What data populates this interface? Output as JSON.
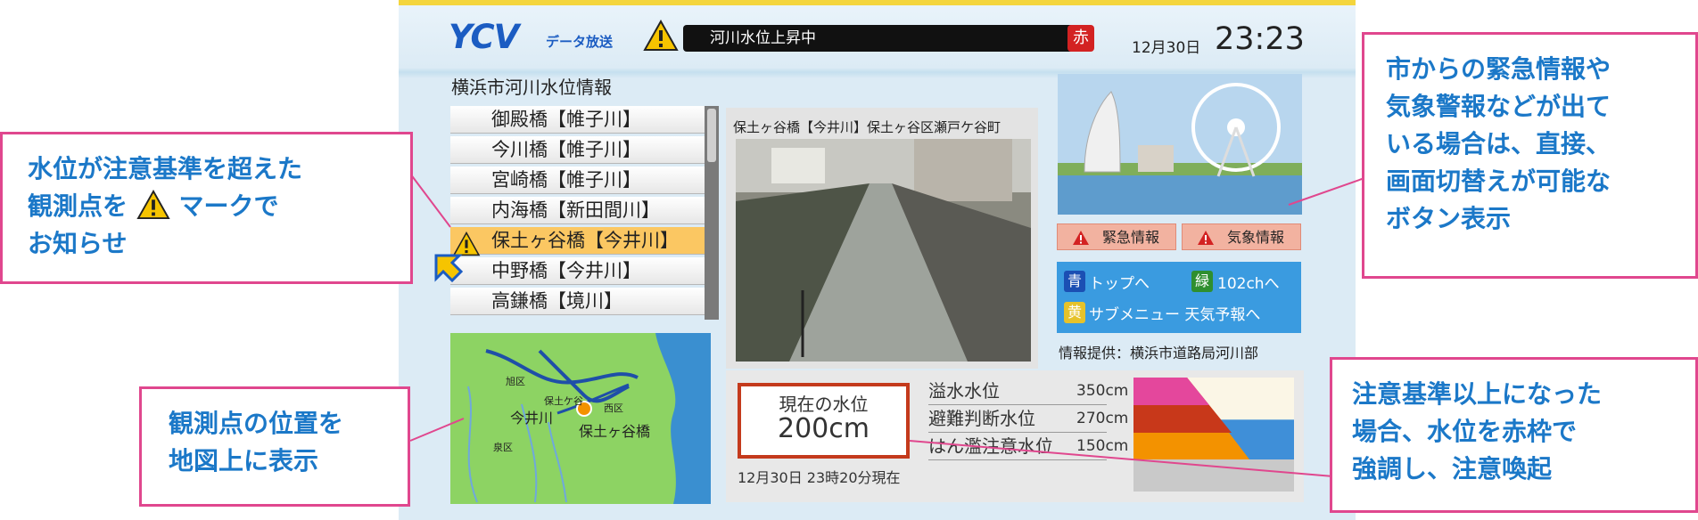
{
  "header": {
    "logo": "YCV",
    "logo_sub": "データ放送",
    "ticker_text": "河川水位上昇中",
    "alert_badge": "赤",
    "date": "12月30日",
    "time": "23:23"
  },
  "section_title": "横浜市河川水位情報",
  "stations": [
    {
      "label": "御殿橋【帷子川】",
      "selected": false
    },
    {
      "label": "今川橋【帷子川】",
      "selected": false
    },
    {
      "label": "宮崎橋【帷子川】",
      "selected": false
    },
    {
      "label": "内海橋【新田間川】",
      "selected": false
    },
    {
      "label": "保土ヶ谷橋【今井川】",
      "selected": true
    },
    {
      "label": "中野橋【今井川】",
      "selected": false
    },
    {
      "label": "高鎌橋【境川】",
      "selected": false
    }
  ],
  "map": {
    "label_a": "旭区",
    "label_b": "保土ケ谷",
    "label_c": "西区",
    "label_d": "今井川",
    "label_e": "保土ヶ谷橋",
    "label_f": "泉区"
  },
  "camera": {
    "caption": "保土ヶ谷橋【今井川】保土ヶ谷区瀬戸ケ谷町"
  },
  "buttons": {
    "emergency": "緊急情報",
    "weather": "気象情報"
  },
  "nav": {
    "blue_key": "青",
    "blue_label": "トップへ",
    "green_key": "緑",
    "green_label": "102chへ",
    "yellow_key": "黄",
    "yellow_label": "サブメニュー 天気予報へ"
  },
  "source": "情報提供：横浜市道路局河川部",
  "water_level": {
    "current_label": "現在の水位",
    "current_value": "200cm",
    "current_value_cm": 200,
    "timestamp": "12月30日 23時20分現在",
    "levels": [
      {
        "label": "溢水水位",
        "value": "350cm",
        "value_cm": 350,
        "color": "#e4479c"
      },
      {
        "label": "避難判断水位",
        "value": "270cm",
        "value_cm": 270,
        "color": "#c8381a"
      },
      {
        "label": "はん濫注意水位",
        "value": "150cm",
        "value_cm": 150,
        "color": "#f39200"
      }
    ]
  },
  "annotations": {
    "left_top_line1": "水位が注意基準を超えた",
    "left_top_line2a": "観測点を",
    "left_top_line2b": "マークで",
    "left_top_line3": "お知らせ",
    "left_bottom_line1": "観測点の位置を",
    "left_bottom_line2": "地図上に表示",
    "right_top_line1": "市からの緊急情報や",
    "right_top_line2": "気象警報などが出て",
    "right_top_line3": "いる場合は、直接、",
    "right_top_line4": "画面切替えが可能な",
    "right_top_line5": "ボタン表示",
    "right_bottom_line1": "注意基準以上になった",
    "right_bottom_line2": "場合、水位を赤枠で",
    "right_bottom_line3": "強調し、注意喚起"
  },
  "colors": {
    "accent_blue": "#1b78c8",
    "annotation_border": "#e0478e",
    "alert_red": "#c43a1c",
    "selected_row": "#fbc762"
  }
}
